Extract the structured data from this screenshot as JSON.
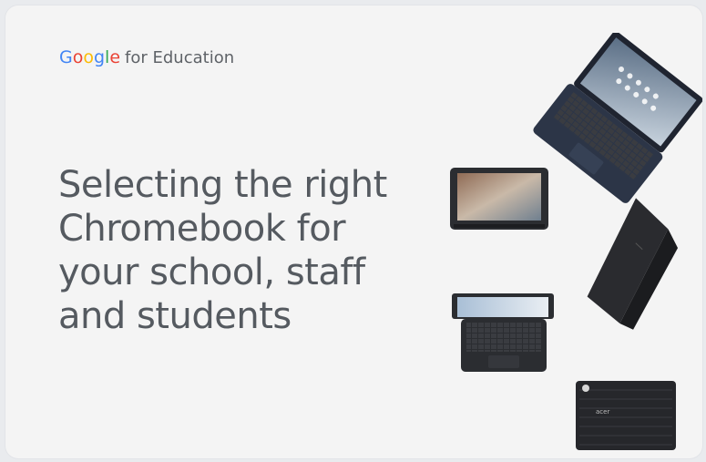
{
  "brand": {
    "google_letters": [
      {
        "ch": "G",
        "color": "#4285F4"
      },
      {
        "ch": "o",
        "color": "#EA4335"
      },
      {
        "ch": "o",
        "color": "#FBBC05"
      },
      {
        "ch": "g",
        "color": "#4285F4"
      },
      {
        "ch": "l",
        "color": "#34A853"
      },
      {
        "ch": "e",
        "color": "#EA4335"
      }
    ],
    "suffix": "for Education"
  },
  "headline": {
    "line1": "Selecting the right",
    "line2": "Chromebook for",
    "line3": "your school, staff",
    "line4": "and students"
  },
  "device_back_logo": "acer",
  "colors": {
    "card_bg": "#f4f4f4",
    "headline": "#555a60",
    "device_dark": "#2b2d31",
    "device_navy": "#2c3547"
  }
}
